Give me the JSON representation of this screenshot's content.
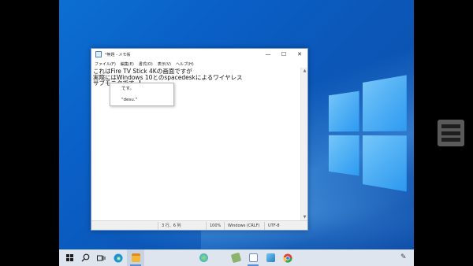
{
  "notepad": {
    "title": "*無題 - メモ帳",
    "controls": {
      "minimize": "—",
      "maximize": "☐",
      "close": "✕"
    },
    "menu": [
      "ファイル(F)",
      "編集(E)",
      "書式(O)",
      "表示(V)",
      "ヘルプ(H)"
    ],
    "lines": [
      "これはFire TV Stick 4Kの画面ですが",
      "実際にはWindows 10とのspacedeskによるワイヤレス",
      "サブモニタです。"
    ],
    "ime_candidates": [
      "です。",
      "\"desu.\""
    ],
    "status": {
      "position": "3 行、6 列",
      "zoom": "100%",
      "line_ending": "Windows (CRLF)",
      "encoding": "UTF-8"
    }
  },
  "taskbar": {
    "icons": [
      "windows-start-icon",
      "search-icon",
      "task-view-icon",
      "edge-icon",
      "file-explorer-icon",
      "app-icon",
      "notepad-icon",
      "notepad-icon-2",
      "app-icon-2",
      "chrome-icon"
    ]
  }
}
